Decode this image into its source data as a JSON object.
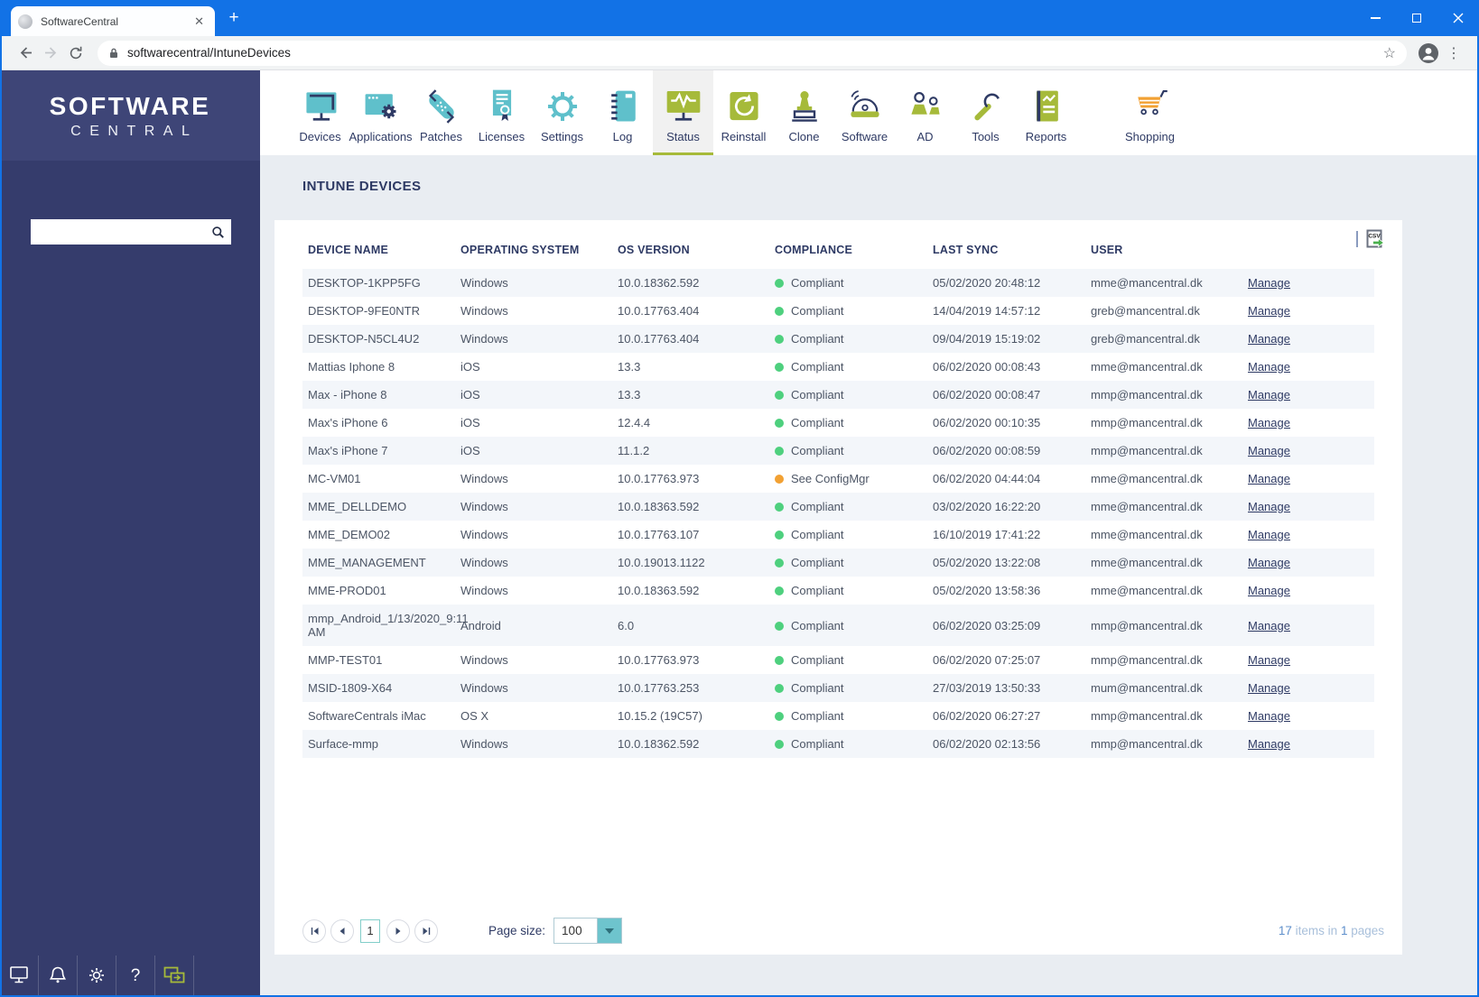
{
  "browser": {
    "tab_title": "SoftwareCentral",
    "url": "softwarecentral/IntuneDevices"
  },
  "colors": {
    "titlebar_blue": "#1272E6",
    "sidebar_navy": "#353C6C",
    "navy_text": "#2E3A64",
    "accent_teal": "#5FC0CB",
    "accent_olive": "#A6BA3A",
    "accent_orange": "#F2A133",
    "status_green": "#4ED07E",
    "status_orange": "#F2A133"
  },
  "sidebar": {
    "logo_line1": "SOFTWARE",
    "logo_line2": "CENTRAL",
    "footer_icons": [
      "computer-icon",
      "bell-icon",
      "gear-icon",
      "help-icon",
      "remote-session-icon"
    ]
  },
  "nav": {
    "items": [
      {
        "label": "Devices",
        "icon": "devices-icon",
        "active": false
      },
      {
        "label": "Applications",
        "icon": "applications-icon",
        "active": false
      },
      {
        "label": "Patches",
        "icon": "patches-icon",
        "active": false
      },
      {
        "label": "Licenses",
        "icon": "licenses-icon",
        "active": false
      },
      {
        "label": "Settings",
        "icon": "settings-icon",
        "active": false
      },
      {
        "label": "Log",
        "icon": "log-icon",
        "active": false
      },
      {
        "label": "Status",
        "icon": "status-icon",
        "active": true
      },
      {
        "label": "Reinstall",
        "icon": "reinstall-icon",
        "active": false
      },
      {
        "label": "Clone",
        "icon": "clone-icon",
        "active": false
      },
      {
        "label": "Software",
        "icon": "software-icon",
        "active": false
      },
      {
        "label": "AD",
        "icon": "ad-icon",
        "active": false
      },
      {
        "label": "Tools",
        "icon": "tools-icon",
        "active": false
      },
      {
        "label": "Reports",
        "icon": "reports-icon",
        "active": false
      },
      {
        "label": "Shopping",
        "icon": "shopping-icon",
        "active": false,
        "gap_before": true
      }
    ]
  },
  "page": {
    "title": "INTUNE DEVICES",
    "export_label": "CSV"
  },
  "table": {
    "columns": [
      "DEVICE NAME",
      "OPERATING SYSTEM",
      "OS VERSION",
      "COMPLIANCE",
      "LAST SYNC",
      "USER",
      ""
    ],
    "rows": [
      {
        "device": "DESKTOP-1KPP5FG",
        "os": "Windows",
        "version": "10.0.18362.592",
        "status": "Compliant",
        "status_color": "status_green",
        "last_sync": "05/02/2020 20:48:12",
        "user": "mme@mancentral.dk",
        "action": "Manage"
      },
      {
        "device": "DESKTOP-9FE0NTR",
        "os": "Windows",
        "version": "10.0.17763.404",
        "status": "Compliant",
        "status_color": "status_green",
        "last_sync": "14/04/2019 14:57:12",
        "user": "greb@mancentral.dk",
        "action": "Manage"
      },
      {
        "device": "DESKTOP-N5CL4U2",
        "os": "Windows",
        "version": "10.0.17763.404",
        "status": "Compliant",
        "status_color": "status_green",
        "last_sync": "09/04/2019 15:19:02",
        "user": "greb@mancentral.dk",
        "action": "Manage"
      },
      {
        "device": "Mattias Iphone 8",
        "os": "iOS",
        "version": "13.3",
        "status": "Compliant",
        "status_color": "status_green",
        "last_sync": "06/02/2020 00:08:43",
        "user": "mme@mancentral.dk",
        "action": "Manage"
      },
      {
        "device": "Max - iPhone 8",
        "os": "iOS",
        "version": "13.3",
        "status": "Compliant",
        "status_color": "status_green",
        "last_sync": "06/02/2020 00:08:47",
        "user": "mmp@mancentral.dk",
        "action": "Manage"
      },
      {
        "device": "Max's iPhone 6",
        "os": "iOS",
        "version": "12.4.4",
        "status": "Compliant",
        "status_color": "status_green",
        "last_sync": "06/02/2020 00:10:35",
        "user": "mmp@mancentral.dk",
        "action": "Manage"
      },
      {
        "device": "Max's iPhone 7",
        "os": "iOS",
        "version": "11.1.2",
        "status": "Compliant",
        "status_color": "status_green",
        "last_sync": "06/02/2020 00:08:59",
        "user": "mmp@mancentral.dk",
        "action": "Manage"
      },
      {
        "device": "MC-VM01",
        "os": "Windows",
        "version": "10.0.17763.973",
        "status": "See ConfigMgr",
        "status_color": "status_orange",
        "last_sync": "06/02/2020 04:44:04",
        "user": "mme@mancentral.dk",
        "action": "Manage"
      },
      {
        "device": "MME_DELLDEMO",
        "os": "Windows",
        "version": "10.0.18363.592",
        "status": "Compliant",
        "status_color": "status_green",
        "last_sync": "03/02/2020 16:22:20",
        "user": "mme@mancentral.dk",
        "action": "Manage"
      },
      {
        "device": "MME_DEMO02",
        "os": "Windows",
        "version": "10.0.17763.107",
        "status": "Compliant",
        "status_color": "status_green",
        "last_sync": "16/10/2019 17:41:22",
        "user": "mme@mancentral.dk",
        "action": "Manage"
      },
      {
        "device": "MME_MANAGEMENT",
        "os": "Windows",
        "version": "10.0.19013.1122",
        "status": "Compliant",
        "status_color": "status_green",
        "last_sync": "05/02/2020 13:22:08",
        "user": "mme@mancentral.dk",
        "action": "Manage"
      },
      {
        "device": "MME-PROD01",
        "os": "Windows",
        "version": "10.0.18363.592",
        "status": "Compliant",
        "status_color": "status_green",
        "last_sync": "05/02/2020 13:58:36",
        "user": "mme@mancentral.dk",
        "action": "Manage"
      },
      {
        "device": "mmp_Android_1/13/2020_9:11 AM",
        "os": "Android",
        "version": "6.0",
        "status": "Compliant",
        "status_color": "status_green",
        "last_sync": "06/02/2020 03:25:09",
        "user": "mmp@mancentral.dk",
        "action": "Manage"
      },
      {
        "device": "MMP-TEST01",
        "os": "Windows",
        "version": "10.0.17763.973",
        "status": "Compliant",
        "status_color": "status_green",
        "last_sync": "06/02/2020 07:25:07",
        "user": "mmp@mancentral.dk",
        "action": "Manage"
      },
      {
        "device": "MSID-1809-X64",
        "os": "Windows",
        "version": "10.0.17763.253",
        "status": "Compliant",
        "status_color": "status_green",
        "last_sync": "27/03/2019 13:50:33",
        "user": "mum@mancentral.dk",
        "action": "Manage"
      },
      {
        "device": "SoftwareCentrals iMac",
        "os": "OS X",
        "version": "10.15.2 (19C57)",
        "status": "Compliant",
        "status_color": "status_green",
        "last_sync": "06/02/2020 06:27:27",
        "user": "mmp@mancentral.dk",
        "action": "Manage"
      },
      {
        "device": "Surface-mmp",
        "os": "Windows",
        "version": "10.0.18362.592",
        "status": "Compliant",
        "status_color": "status_green",
        "last_sync": "06/02/2020 02:13:56",
        "user": "mmp@mancentral.dk",
        "action": "Manage"
      }
    ]
  },
  "pagination": {
    "page": "1",
    "page_size_label": "Page size:",
    "page_size": "100",
    "summary_count": "17",
    "summary_mid": " items in ",
    "summary_pages": "1",
    "summary_end": " pages"
  }
}
